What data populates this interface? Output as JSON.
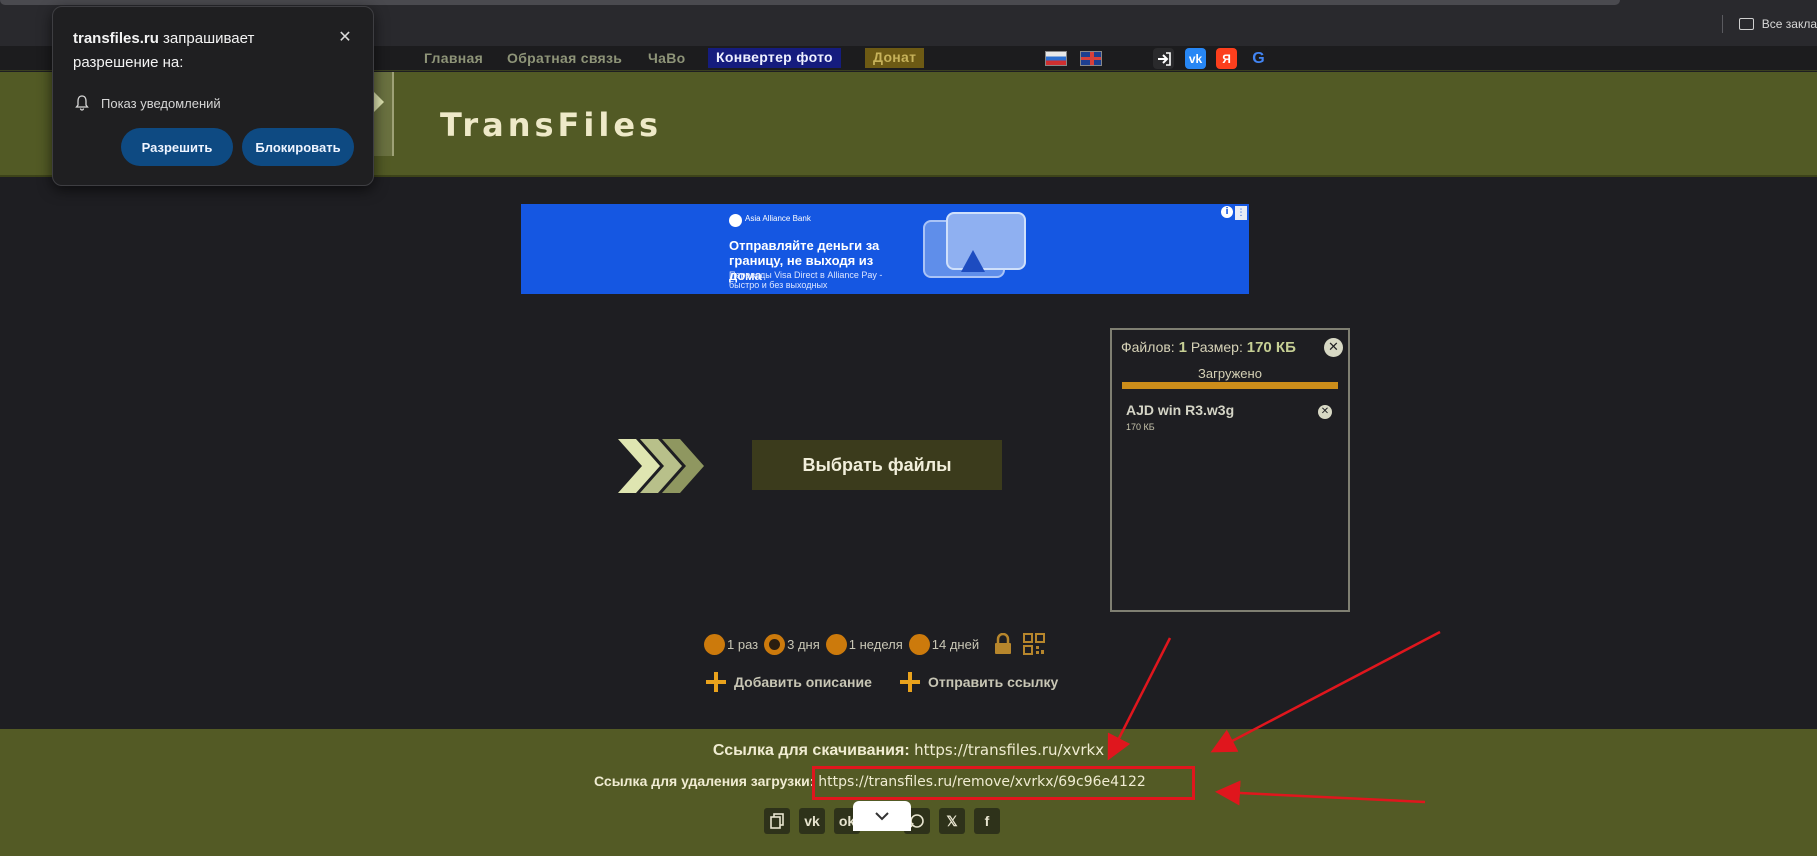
{
  "browser": {
    "bookmarks_label": "Все закла"
  },
  "nav": {
    "items": [
      "Главная",
      "Обратная связь",
      "ЧаВо"
    ],
    "converter": "Конвертер фото",
    "donate": "Донат",
    "social": [
      "login-icon",
      "vk-icon",
      "yandex-icon",
      "google-icon"
    ],
    "vk_label": "vk",
    "yandex_label": "Я",
    "google_label": "G"
  },
  "header": {
    "title": "TransFiles"
  },
  "ad": {
    "brand": "Asia Alliance Bank",
    "headline": "Отправляйте деньги за границу, не выходя из дома",
    "sub": "Переводы Visa Direct в Alliance Pay - быстро и без выходных",
    "info": "i",
    "menu": "⋮"
  },
  "upload": {
    "select_button": "Выбрать файлы"
  },
  "files_panel": {
    "files_label": "Файлов:",
    "files_count": "1",
    "size_label": "Размер:",
    "size_value": "170 КБ",
    "status": "Загружено",
    "progress_percent": 100,
    "close": "✕",
    "file": {
      "name": "AJD win R3.w3g",
      "size": "170 КБ",
      "remove": "✕"
    }
  },
  "retention": {
    "options": [
      {
        "label": "1 раз",
        "selected": false
      },
      {
        "label": "3 дня",
        "selected": true
      },
      {
        "label": "1 неделя",
        "selected": false
      },
      {
        "label": "14 дней",
        "selected": false
      }
    ]
  },
  "actions": {
    "add_description": "Добавить описание",
    "send_link": "Отправить ссылку"
  },
  "links": {
    "download_label": "Ссылка для скачивания:",
    "download_url": "https://transfiles.ru/xvrkx",
    "remove_label": "Ссылка для удаления загрузки:",
    "remove_url": "https://transfiles.ru/remove/xvrkx/69c96e4122"
  },
  "share": {
    "icons": [
      "copy-icon",
      "vk-icon",
      "ok-icon",
      "whatsapp-icon",
      "x-icon",
      "facebook-icon"
    ],
    "vk": "vk",
    "ok": "ok",
    "x": "𝕏",
    "fb": "f"
  },
  "popup": {
    "site": "transfiles.ru",
    "title_rest": "запрашивает разрешение на:",
    "permission": "Показ уведомлений",
    "allow": "Разрешить",
    "block": "Блокировать",
    "close": "✕"
  },
  "colors": {
    "accent_orange": "#cc7a0c",
    "header_olive": "#525a25",
    "annotation_red": "#e0161d",
    "popup_button": "#0e4a82"
  }
}
